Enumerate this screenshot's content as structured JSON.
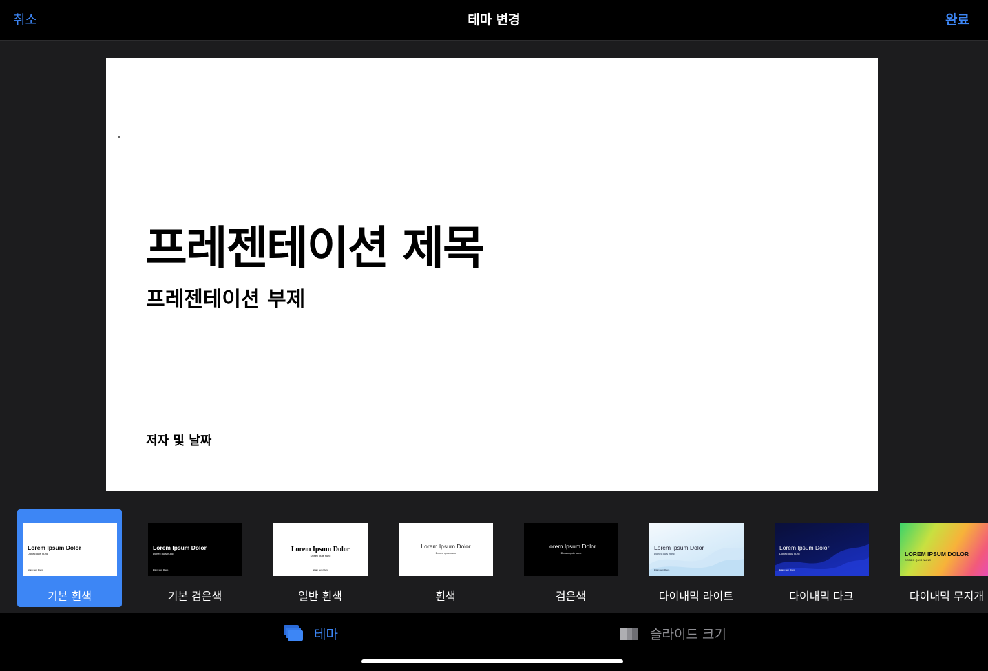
{
  "topbar": {
    "cancel_label": "취소",
    "title": "테마 변경",
    "done_label": "완료"
  },
  "slide": {
    "title": "프레젠테이션 제목",
    "subtitle": "프레젠테이션 부제",
    "author": "저자 및 날짜"
  },
  "themes": [
    {
      "name": "기본 흰색",
      "thumb_title": "Lorem Ipsum Dolor",
      "thumb_sub": "Donec quis nunc",
      "thumb_foot": "Etiam sem libero",
      "selected": true
    },
    {
      "name": "기본 검은색",
      "thumb_title": "Lorem Ipsum Dolor",
      "thumb_sub": "Donec quis nunc",
      "thumb_foot": "Etiam sem libero"
    },
    {
      "name": "일반 흰색",
      "thumb_title": "Lorem Ipsum Dolor",
      "thumb_sub": "Donec quis nunc",
      "thumb_foot": "Etiam sem libero"
    },
    {
      "name": "흰색",
      "thumb_title": "Lorem Ipsum Dolor",
      "thumb_sub": "Donec quis nunc"
    },
    {
      "name": "검은색",
      "thumb_title": "Lorem Ipsum Dolor",
      "thumb_sub": "Donec quis nunc"
    },
    {
      "name": "다이내믹 라이트",
      "thumb_title": "Lorem Ipsum Dolor",
      "thumb_sub": "Donec quis nunc",
      "thumb_foot": "Etiam sem libero"
    },
    {
      "name": "다이내믹 다크",
      "thumb_title": "Lorem Ipsum Dolor",
      "thumb_sub": "Donec quis nunc",
      "thumb_foot": "Etiam sem libero"
    },
    {
      "name": "다이내믹 무지개",
      "thumb_title": "LOREM IPSUM DOLOR",
      "thumb_sub": "DONEC QUIS NUNC"
    }
  ],
  "tabs": {
    "theme_label": "테마",
    "slide_size_label": "슬라이드 크기"
  },
  "colors": {
    "accent": "#3d86f5",
    "background": "#1c1c1e",
    "bar": "#000000",
    "inactive_tab": "#8e8e93"
  },
  "icons": {
    "theme_tab": "stacked-slides-icon",
    "slide_size_tab": "slide-size-icon"
  }
}
